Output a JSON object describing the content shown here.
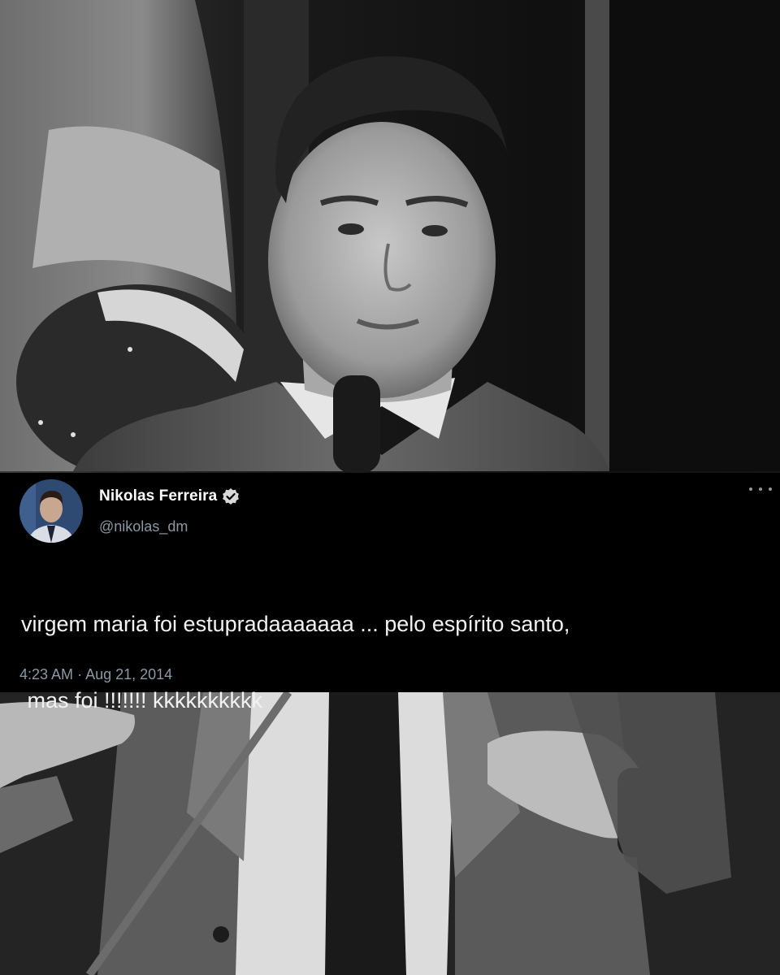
{
  "tweet": {
    "display_name": "Nikolas Ferreira",
    "handle": "@nikolas_dm",
    "text_line1": "virgem maria foi estupradaaaaaaa ... pelo espírito santo,",
    "text_line2": " mas foi !!!!!!! kkkkkkkkkk",
    "time": "4:23 AM",
    "separator": "·",
    "date": "Aug 21, 2014",
    "verified": true,
    "icons": {
      "verified": "verified-badge-icon",
      "more": "more-options-icon"
    }
  },
  "background": {
    "description_style": "black-and-white photo",
    "photo_tones": {
      "dark": "#0d0d0d",
      "mid": "#5a5a5a",
      "light": "#d8d8d8"
    }
  },
  "colors": {
    "tweet_bg": "#000000",
    "text": "#f2f2f2",
    "secondary": "#8b98a5"
  }
}
